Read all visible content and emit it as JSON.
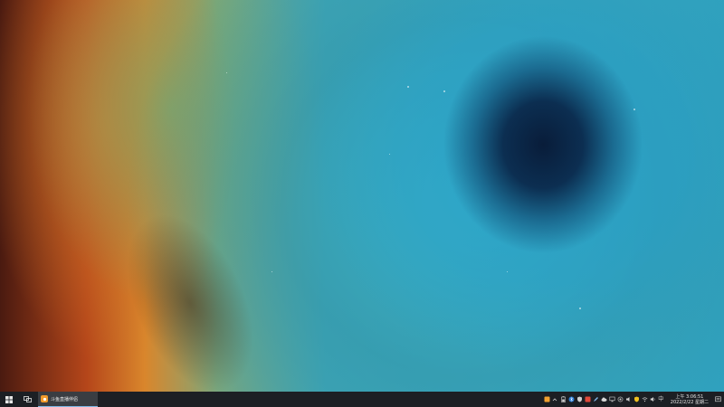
{
  "taskbar": {
    "apps": [
      {
        "label": "斗鱼直播伴侣",
        "icon": "douyu-app-icon"
      }
    ],
    "tray": {
      "icons": [
        "notification-orange-icon",
        "chevron-icon",
        "battery-icon",
        "bluetooth-icon",
        "shield-icon",
        "red-app-icon",
        "pen-icon",
        "cloud-icon",
        "network-icon",
        "cast-icon",
        "volume-icon",
        "security-shield-icon",
        "wifi-icon",
        "speaker-icon",
        "ime-icon"
      ],
      "ime_label": "中"
    },
    "clock": {
      "time": "上午 3:06:51",
      "date": "2022/2/22 星期二"
    }
  },
  "colors": {
    "taskbar_bg": "#1c1f24",
    "active_app_bg": "#3a3d42",
    "active_indicator": "#7eb8e6",
    "app_icon": "#f09a2b"
  }
}
